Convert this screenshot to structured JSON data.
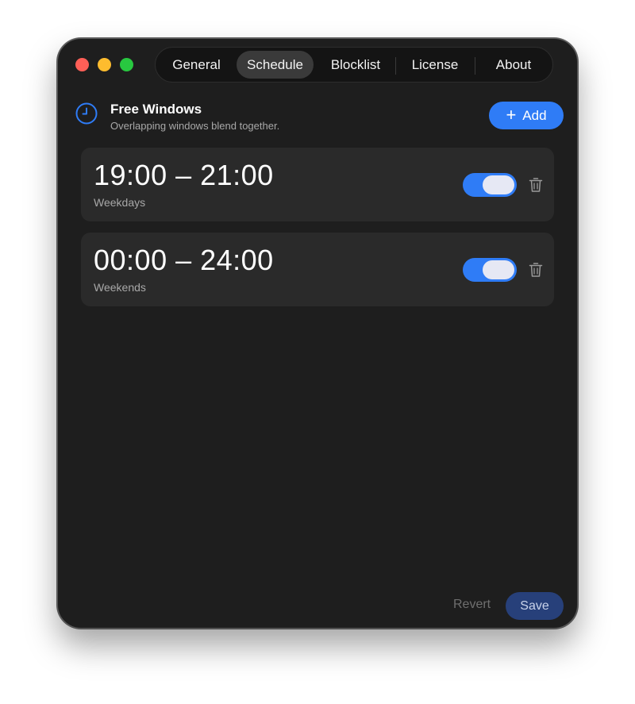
{
  "window_controls": {
    "close_color": "#ff5f57",
    "minimize_color": "#febc2e",
    "zoom_color": "#28c840"
  },
  "tabs": [
    {
      "label": "General",
      "active": false
    },
    {
      "label": "Schedule",
      "active": true
    },
    {
      "label": "Blocklist",
      "active": false
    },
    {
      "label": "License",
      "active": false
    },
    {
      "label": "About",
      "active": false
    }
  ],
  "header": {
    "icon": "clock-icon",
    "title": "Free Windows",
    "subtitle": "Overlapping windows blend together.",
    "add_label": "Add"
  },
  "windows": [
    {
      "time": "19:00 – 21:00",
      "days": "Weekdays",
      "enabled": true
    },
    {
      "time": "00:00 – 24:00",
      "days": "Weekends",
      "enabled": true
    }
  ],
  "footer": {
    "revert_label": "Revert",
    "save_label": "Save"
  },
  "colors": {
    "accent": "#2f7cf6",
    "background": "#1e1e1e",
    "card": "#2a2a2a"
  }
}
